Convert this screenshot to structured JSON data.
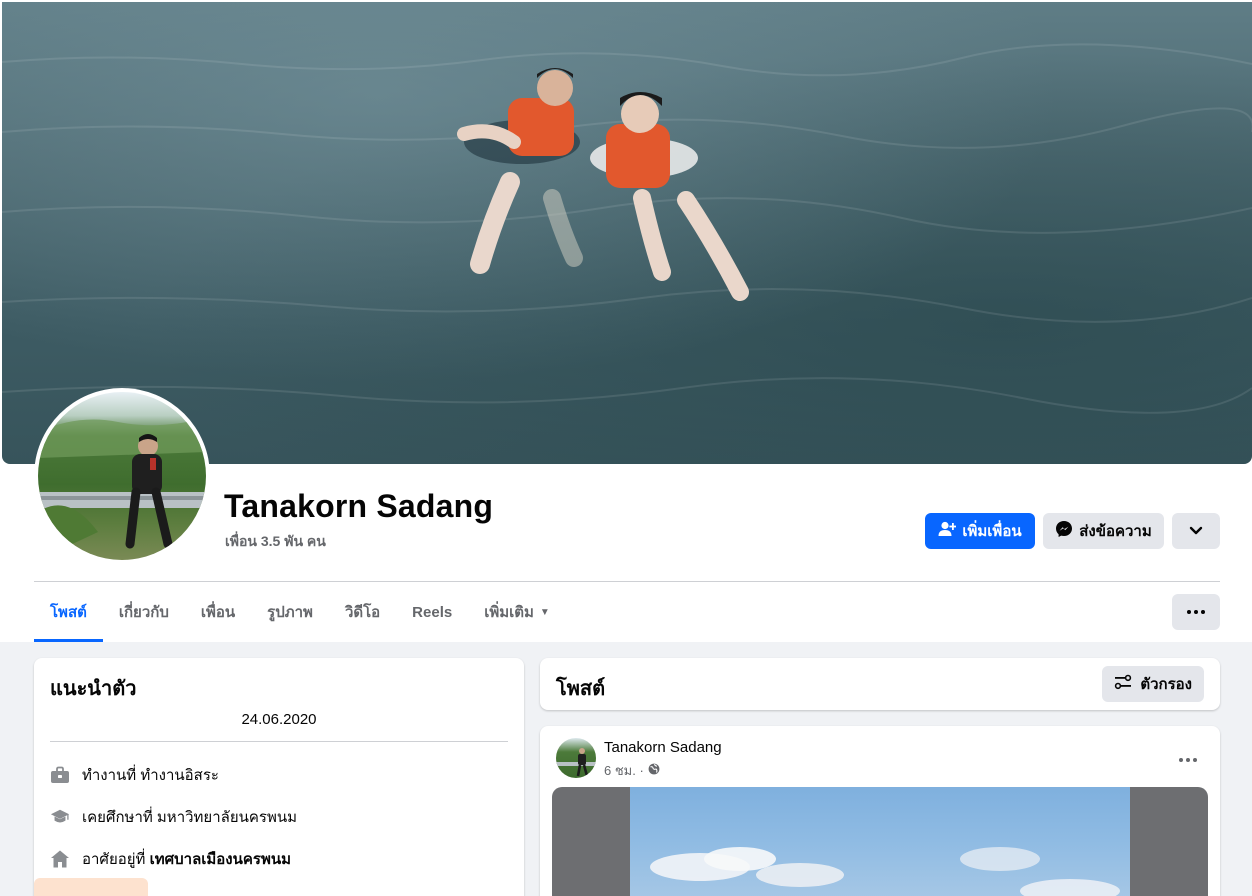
{
  "profile": {
    "name": "Tanakorn Sadang",
    "friends_count": "เพื่อน 3.5 พัน คน"
  },
  "actions": {
    "add_friend": "เพิ่มเพื่อน",
    "message": "ส่งข้อความ"
  },
  "tabs": [
    {
      "label": "โพสต์",
      "active": true
    },
    {
      "label": "เกี่ยวกับ",
      "active": false
    },
    {
      "label": "เพื่อน",
      "active": false
    },
    {
      "label": "รูปภาพ",
      "active": false
    },
    {
      "label": "วิดีโอ",
      "active": false
    },
    {
      "label": "Reels",
      "active": false
    },
    {
      "label": "เพิ่มเติม",
      "active": false
    }
  ],
  "intro": {
    "title": "แนะนำตัว",
    "bio": "24.06.2020",
    "work": "ทำงานที่ ทำงานอิสระ",
    "education": "เคยศึกษาที่ มหาวิทยาลัยนครพนม",
    "lives_prefix": "อาศัยอยู่ที่",
    "lives_place": "เทศบาลเมืองนครพนม"
  },
  "posts": {
    "title": "โพสต์",
    "filter_label": "ตัวกรอง"
  },
  "post": {
    "author": "Tanakorn Sadang",
    "time": "6 ชม. ·"
  },
  "colors": {
    "accent": "#0866ff",
    "secondary_button": "#e4e6eb",
    "page_background": "#f0f2f5",
    "muted_text": "#65676b"
  },
  "icons": [
    "add-friend-icon",
    "messenger-icon",
    "chevron-down-icon",
    "more-icon",
    "filter-icon",
    "briefcase-icon",
    "graduation-cap-icon",
    "home-icon",
    "globe-icon"
  ]
}
